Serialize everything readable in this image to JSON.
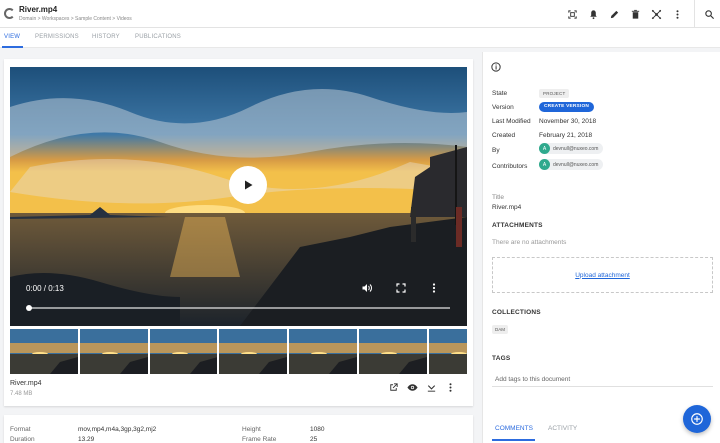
{
  "header": {
    "title": "River.mp4",
    "breadcrumb": "Domain > Workspaces > Sample Content > Videos",
    "actions": [
      "expand-icon",
      "bell-icon",
      "pencil-icon",
      "trash-icon",
      "cluster-icon",
      "more-vert-icon",
      "search-icon"
    ]
  },
  "tabs": {
    "view": "VIEW",
    "permissions": "PERMISSIONS",
    "history": "HISTORY",
    "publications": "PUBLICATIONS",
    "active": "VIEW"
  },
  "player": {
    "time": "0:00 / 0:13",
    "progress": 0.0
  },
  "file": {
    "name": "River.mp4",
    "size": "7.48 MB"
  },
  "metadata": {
    "format_label": "Format",
    "format_value": "mov,mp4,m4a,3gp,3g2,mj2",
    "duration_label": "Duration",
    "duration_value": "13.29",
    "height_label": "Height",
    "height_value": "1080",
    "framerate_label": "Frame Rate",
    "framerate_value": "25"
  },
  "sidebar": {
    "state_label": "State",
    "state_value": "PROJECT",
    "version_label": "Version",
    "version_button": "CREATE VERSION",
    "last_modified_label": "Last Modified",
    "last_modified_value": "November 30, 2018",
    "created_label": "Created",
    "created_value": "February 21, 2018",
    "by_label": "By",
    "by_user": "devnull@nuxeo.com",
    "contributors_label": "Contributors",
    "contributor_user": "devnull@nuxeo.com",
    "avatar_initial": "A",
    "title_label": "Title",
    "title_value": "River.mp4",
    "attachments_heading": "ATTACHMENTS",
    "no_attachments": "There are no attachments",
    "upload_link": "Upload attachment",
    "collections_heading": "COLLECTIONS",
    "collection_item": "DAM",
    "tags_heading": "TAGS",
    "tags_placeholder": "Add tags to this document",
    "comments_tab": "COMMENTS",
    "activity_tab": "ACTIVITY"
  },
  "colors": {
    "accent": "#1f66d9",
    "tab_active": "#2d6cdf",
    "avatar": "#2fa98d"
  }
}
